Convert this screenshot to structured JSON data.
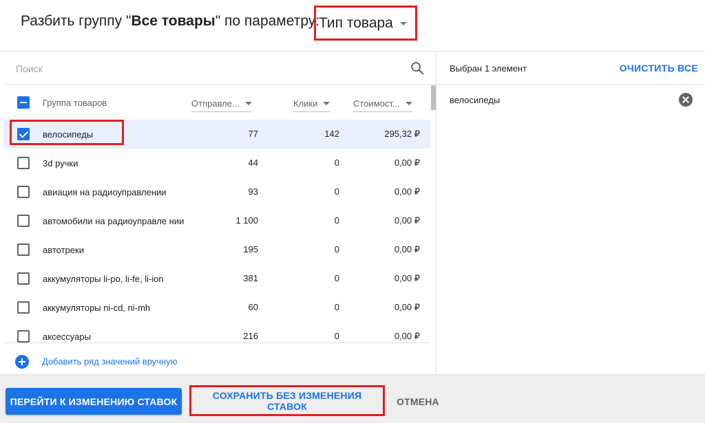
{
  "header": {
    "title_prefix": "Разбить группу \"",
    "group_name": "Все товары",
    "title_suffix": "\" по параметру:",
    "parameter": "Тип товара"
  },
  "search": {
    "placeholder": "Поиск"
  },
  "table": {
    "columns": {
      "group": "Группа товаров",
      "sent": "Отправле...",
      "clicks": "Клики",
      "cost": "Стоимост..."
    },
    "rows": [
      {
        "name": "велосипеды",
        "sent": "77",
        "clicks": "142",
        "cost": "295,32 ₽",
        "checked": true
      },
      {
        "name": "3d ручки",
        "sent": "44",
        "clicks": "0",
        "cost": "0,00 ₽",
        "checked": false
      },
      {
        "name": "авиация на радиоуправлении",
        "sent": "93",
        "clicks": "0",
        "cost": "0,00 ₽",
        "checked": false
      },
      {
        "name": "автомобили на радиоуправле нии",
        "sent": "1 100",
        "clicks": "0",
        "cost": "0,00 ₽",
        "checked": false
      },
      {
        "name": "автотреки",
        "sent": "195",
        "clicks": "0",
        "cost": "0,00 ₽",
        "checked": false
      },
      {
        "name": "аккумуляторы li-po, li-fe, li-ion",
        "sent": "381",
        "clicks": "0",
        "cost": "0,00 ₽",
        "checked": false
      },
      {
        "name": "аккумуляторы ni-cd, ni-mh",
        "sent": "60",
        "clicks": "0",
        "cost": "0,00 ₽",
        "checked": false
      },
      {
        "name": "аксессуары",
        "sent": "216",
        "clicks": "0",
        "cost": "0,00 ₽",
        "checked": false
      }
    ],
    "add_row_label": "Добавить ряд значений вручную"
  },
  "selection": {
    "count_label": "Выбран 1 элемент",
    "clear_all": "ОЧИСТИТЬ ВСЕ",
    "items": [
      "велосипеды"
    ]
  },
  "footer": {
    "primary": "ПЕРЕЙТИ К ИЗМЕНЕНИЮ СТАВОК",
    "save": "СОХРАНИТЬ БЕЗ ИЗМЕНЕНИЯ СТАВОК",
    "cancel": "ОТМЕНА"
  },
  "colors": {
    "accent": "#1a73e8",
    "highlight": "#e02020",
    "selected_row": "#e8f0fe"
  },
  "icons": {
    "search": "search-icon",
    "add": "add-circle-icon",
    "remove": "remove-circle-icon",
    "sort": "caret-down-icon"
  }
}
